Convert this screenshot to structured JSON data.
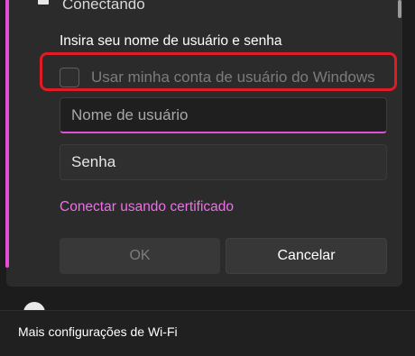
{
  "dialog": {
    "title": "Conectando",
    "prompt": "Insira seu nome de usuário e senha",
    "use_windows_account_label": "Usar minha conta de usuário do Windows",
    "use_windows_account_checked": false,
    "username_placeholder": "Nome de usuário",
    "password_placeholder": "Senha",
    "certificate_link": "Conectar usando certificado",
    "ok_label": "OK",
    "cancel_label": "Cancelar"
  },
  "footer": {
    "more_settings_label": "Mais configurações de Wi-Fi"
  },
  "colors": {
    "accent": "#e04fd4",
    "highlight_annotation": "#e01b24"
  },
  "icons": {
    "network": "wifi-icon",
    "next_network": "wifi-icon"
  }
}
